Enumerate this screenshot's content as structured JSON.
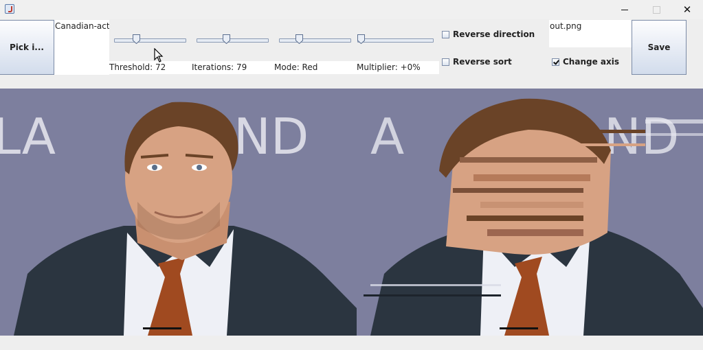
{
  "window": {
    "minimize_label": "—",
    "close_label": "✕"
  },
  "toolbar": {
    "pick_label": "Pick i...",
    "input_filename": "Canadian-acto",
    "save_label": "Save",
    "output_filename": "out.png"
  },
  "sliders": [
    {
      "label": "Threshold: 72",
      "value_fraction": 0.29
    },
    {
      "label": "Iterations: 79",
      "value_fraction": 0.4
    },
    {
      "label": "Mode: Red",
      "value_fraction": 0.25
    },
    {
      "label": "Multiplier: +0%",
      "value_fraction": 0.0
    }
  ],
  "options": {
    "reverse_direction": {
      "label": "Reverse direction",
      "checked": false
    },
    "reverse_sort": {
      "label": "Reverse sort",
      "checked": false
    },
    "change_axis": {
      "label": "Change axis",
      "checked": true
    }
  },
  "colors": {
    "backdrop": "#7d7f9e",
    "suit": "#2b3540",
    "tie": "#a04a20",
    "skin": "#d7a283",
    "hair": "#6a4327"
  }
}
